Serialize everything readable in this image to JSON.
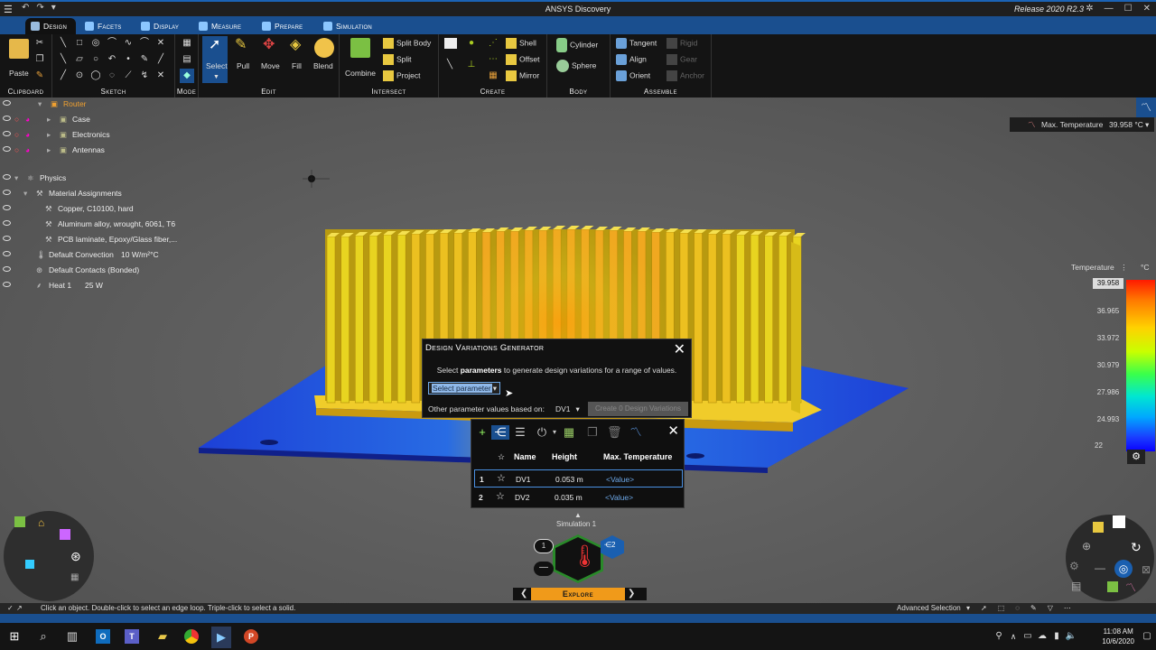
{
  "window": {
    "title": "ANSYS Discovery",
    "release": "Release 2020 R2.3"
  },
  "tabs": [
    {
      "label": "Design",
      "active": true
    },
    {
      "label": "Facets"
    },
    {
      "label": "Display"
    },
    {
      "label": "Measure"
    },
    {
      "label": "Prepare"
    },
    {
      "label": "Simulation"
    }
  ],
  "ribbon": {
    "groups": {
      "clipboard": "Clipboard",
      "sketch": "Sketch",
      "mode": "Mode",
      "edit": "Edit",
      "intersect": "Intersect",
      "create": "Create",
      "body": "Body",
      "assemble": "Assemble"
    },
    "paste": "Paste",
    "select": "Select",
    "pull": "Pull",
    "move": "Move",
    "fill": "Fill",
    "blend": "Blend",
    "combine": "Combine",
    "split_body": "Split Body",
    "split": "Split",
    "project": "Project",
    "shell": "Shell",
    "offset": "Offset",
    "mirror": "Mirror",
    "cylinder": "Cylinder",
    "sphere": "Sphere",
    "tangent": "Tangent",
    "align": "Align",
    "orient": "Orient",
    "rigid": "Rigid",
    "gear": "Gear",
    "anchor": "Anchor"
  },
  "tree": {
    "root": "Router",
    "parts": [
      "Case",
      "Electronics",
      "Antennas"
    ],
    "physics": "Physics",
    "material_assignments": "Material Assignments",
    "materials": [
      "Copper, C10100, hard",
      "Aluminum alloy, wrought, 6061, T6",
      "PCB laminate, Epoxy/Glass fiber,..."
    ],
    "convection_label": "Default Convection",
    "convection_value": "10 W/m²°C",
    "contacts": "Default Contacts (Bonded)",
    "heat_label": "Heat 1",
    "heat_value": "25 W"
  },
  "legend_top": {
    "label": "Max. Temperature",
    "value": "39.958 °C"
  },
  "temperature_scale": {
    "title": "Temperature",
    "unit": "°C",
    "ticks": [
      "39.958",
      "36.965",
      "33.972",
      "30.979",
      "27.986",
      "24.993",
      "22"
    ]
  },
  "dialog": {
    "title": "Design Variations Generator",
    "message_pre": "Select ",
    "message_bold": "parameters",
    "message_post": " to generate design variations for a range of values.",
    "select_parameter": "Select parameter",
    "other_label": "Other parameter values based on:",
    "other_value": "DV1",
    "create_label": "Create  0  Design Variations"
  },
  "dv_table": {
    "headers": {
      "name": "Name",
      "height": "Height",
      "max_temp": "Max. Temperature"
    },
    "rows": [
      {
        "index": "1",
        "name": "DV1",
        "height": "0.053 m",
        "value": "<Value>"
      },
      {
        "index": "2",
        "name": "DV2",
        "height": "0.035 m",
        "value": "<Value>"
      }
    ]
  },
  "simulation": {
    "label": "Simulation 1",
    "left_badge": "1",
    "right_badge": "2",
    "explore": "Explore"
  },
  "status": {
    "hint": "Click an object. Double-click to select an edge loop. Triple-click to select a solid.",
    "mode": "Advanced Selection"
  },
  "clock": {
    "time": "11:08 AM",
    "date": "10/6/2020"
  },
  "colors": {
    "accent_blue": "#1a4f8f",
    "explore_orange": "#f09a1a",
    "heatsink_yellow": "#e8d21e"
  }
}
